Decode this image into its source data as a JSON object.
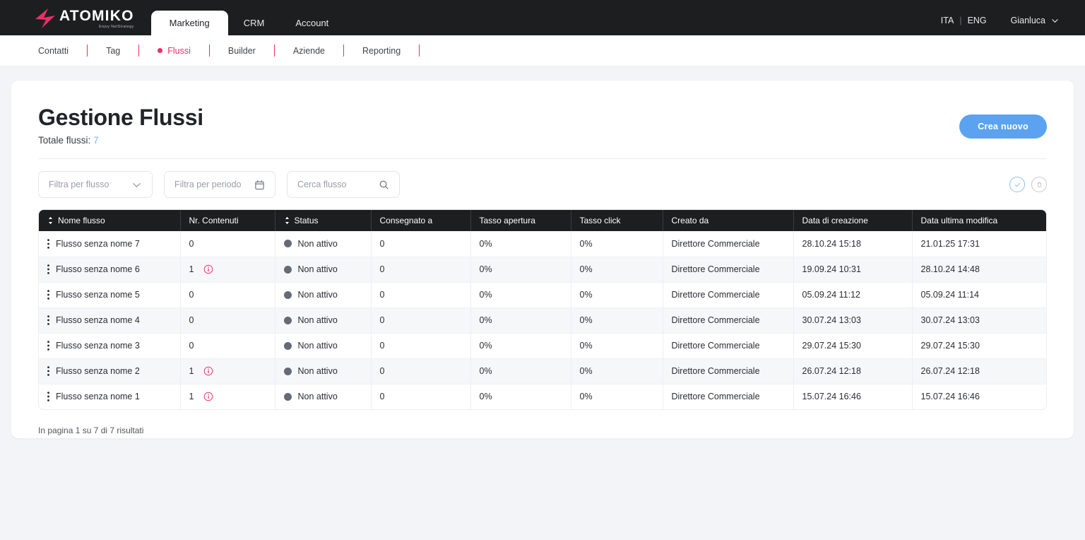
{
  "brand": {
    "name": "ATOMIKO",
    "tagline": "Enjoy NetStrategy"
  },
  "topnav": {
    "tabs": [
      {
        "label": "Marketing",
        "active": true
      },
      {
        "label": "CRM",
        "active": false
      },
      {
        "label": "Account",
        "active": false
      }
    ],
    "lang_it": "ITA",
    "lang_sep": "|",
    "lang_en": "ENG",
    "user": "Gianluca"
  },
  "subnav": {
    "items": [
      {
        "label": "Contatti",
        "active": false
      },
      {
        "label": "Tag",
        "active": false
      },
      {
        "label": "Flussi",
        "active": true
      },
      {
        "label": "Builder",
        "active": false
      },
      {
        "label": "Aziende",
        "active": false
      },
      {
        "label": "Reporting",
        "active": false
      }
    ]
  },
  "page": {
    "title": "Gestione Flussi",
    "subtitle_label": "Totale flussi:",
    "subtitle_count": "7",
    "create_button": "Crea nuovo"
  },
  "filters": {
    "flow_placeholder": "Filtra per flusso",
    "period_placeholder": "Filtra per periodo",
    "search_placeholder": "Cerca flusso"
  },
  "table": {
    "columns": [
      {
        "label": "Nome flusso",
        "sortable": true
      },
      {
        "label": "Nr. Contenuti",
        "sortable": false
      },
      {
        "label": "Status",
        "sortable": true
      },
      {
        "label": "Consegnato a",
        "sortable": false
      },
      {
        "label": "Tasso apertura",
        "sortable": false
      },
      {
        "label": "Tasso click",
        "sortable": false
      },
      {
        "label": "Creato da",
        "sortable": false
      },
      {
        "label": "Data di creazione",
        "sortable": false
      },
      {
        "label": "Data ultima modifica",
        "sortable": false
      }
    ],
    "rows": [
      {
        "name": "Flusso senza nome 7",
        "contents": "0",
        "has_info": false,
        "status": "Non attivo",
        "delivered": "0",
        "open_rate": "0%",
        "click_rate": "0%",
        "created_by": "Direttore Commerciale",
        "created_at": "28.10.24 15:18",
        "updated_at": "21.01.25 17:31"
      },
      {
        "name": "Flusso senza nome 6",
        "contents": "1",
        "has_info": true,
        "status": "Non attivo",
        "delivered": "0",
        "open_rate": "0%",
        "click_rate": "0%",
        "created_by": "Direttore Commerciale",
        "created_at": "19.09.24 10:31",
        "updated_at": "28.10.24 14:48"
      },
      {
        "name": "Flusso senza nome 5",
        "contents": "0",
        "has_info": false,
        "status": "Non attivo",
        "delivered": "0",
        "open_rate": "0%",
        "click_rate": "0%",
        "created_by": "Direttore Commerciale",
        "created_at": "05.09.24 11:12",
        "updated_at": "05.09.24 11:14"
      },
      {
        "name": "Flusso senza nome 4",
        "contents": "0",
        "has_info": false,
        "status": "Non attivo",
        "delivered": "0",
        "open_rate": "0%",
        "click_rate": "0%",
        "created_by": "Direttore Commerciale",
        "created_at": "30.07.24 13:03",
        "updated_at": "30.07.24 13:03"
      },
      {
        "name": "Flusso senza nome 3",
        "contents": "0",
        "has_info": false,
        "status": "Non attivo",
        "delivered": "0",
        "open_rate": "0%",
        "click_rate": "0%",
        "created_by": "Direttore Commerciale",
        "created_at": "29.07.24 15:30",
        "updated_at": "29.07.24 15:30"
      },
      {
        "name": "Flusso senza nome 2",
        "contents": "1",
        "has_info": true,
        "status": "Non attivo",
        "delivered": "0",
        "open_rate": "0%",
        "click_rate": "0%",
        "created_by": "Direttore Commerciale",
        "created_at": "26.07.24 12:18",
        "updated_at": "26.07.24 12:18"
      },
      {
        "name": "Flusso senza nome 1",
        "contents": "1",
        "has_info": true,
        "status": "Non attivo",
        "delivered": "0",
        "open_rate": "0%",
        "click_rate": "0%",
        "created_by": "Direttore Commerciale",
        "created_at": "15.07.24 16:46",
        "updated_at": "15.07.24 16:46"
      }
    ]
  },
  "pagination": {
    "text": "In pagina 1 su 7 di 7 risultati"
  },
  "icons": {
    "check_circle": "check-circle-icon",
    "trash_circle": "trash-circle-icon",
    "calendar": "calendar-icon",
    "search": "search-icon",
    "chevron_down": "chevron-down-icon",
    "info": "info-icon",
    "kebab": "kebab-menu-icon",
    "sort": "sort-arrows-icon"
  },
  "colors": {
    "accent_pink": "#ea2f68",
    "accent_blue": "#5ba3f0",
    "count_blue": "#7db6ef",
    "header_dark": "#1d1e20",
    "status_grey": "#646a76",
    "page_bg": "#f3f4f8"
  }
}
